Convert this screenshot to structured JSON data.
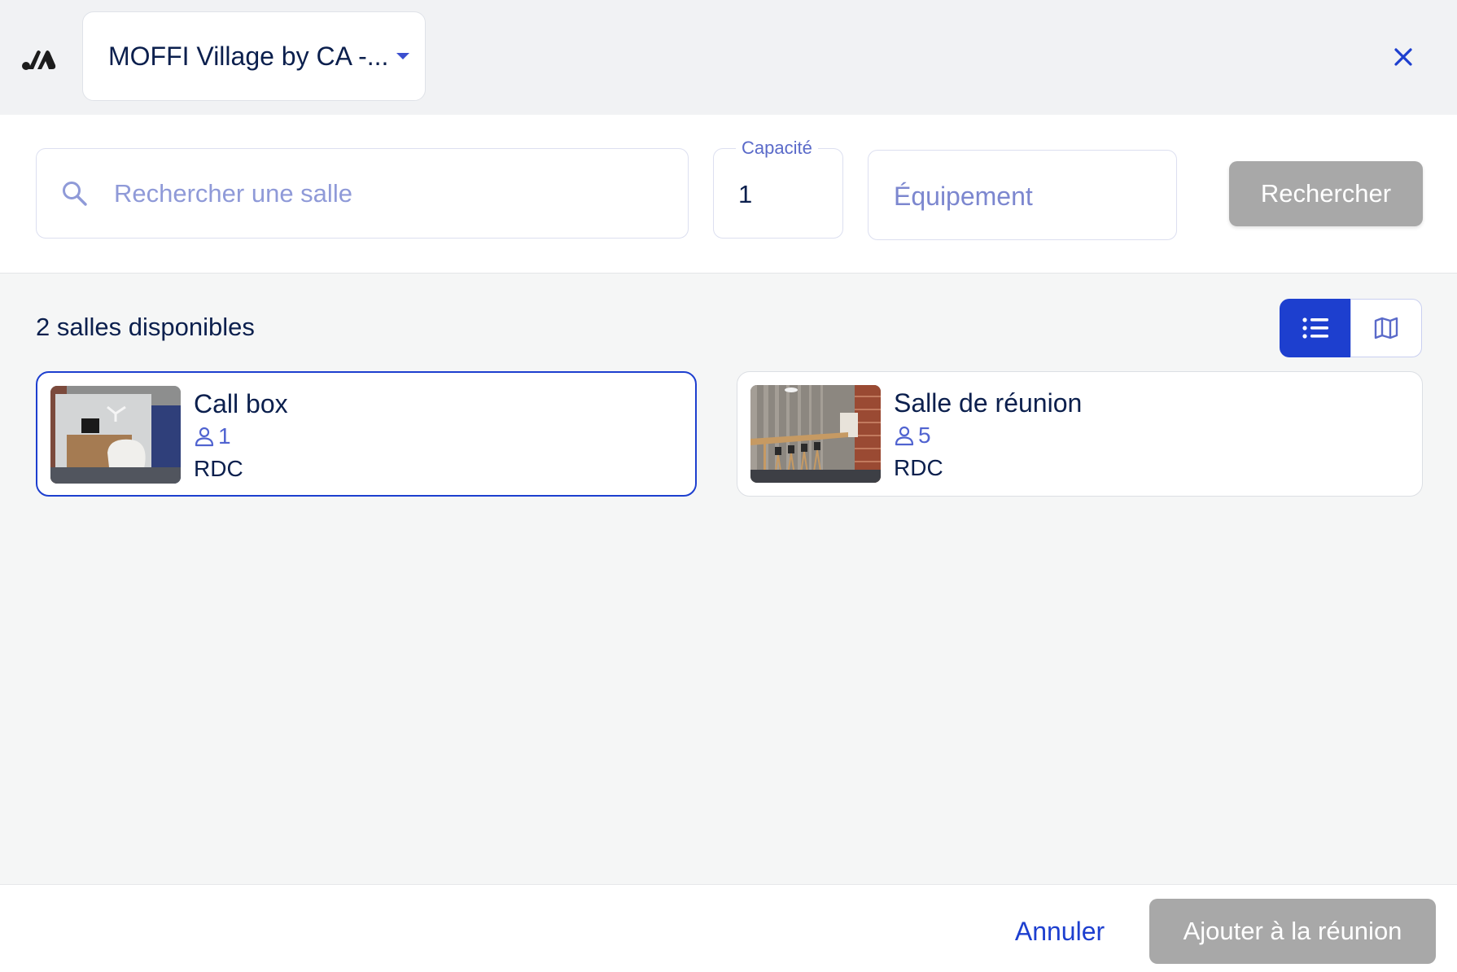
{
  "header": {
    "site_selector": {
      "label": "MOFFI Village by CA -..."
    },
    "icons": {
      "logo": "moffi-logo",
      "caret": "caret-down-icon",
      "close": "close-icon"
    }
  },
  "search": {
    "room_query": {
      "placeholder": "Rechercher une salle",
      "value": ""
    },
    "capacity": {
      "label": "Capacité",
      "value": "1"
    },
    "equipment": {
      "placeholder": "Équipement"
    },
    "submit_label": "Rechercher"
  },
  "results": {
    "count_label": "2 salles disponibles",
    "view_toggle": {
      "active": "list",
      "options": [
        "list-icon",
        "map-icon"
      ]
    },
    "rooms": [
      {
        "name": "Call box",
        "capacity": "1",
        "floor": "RDC",
        "selected": true
      },
      {
        "name": "Salle de réunion",
        "capacity": "5",
        "floor": "RDC",
        "selected": false
      }
    ]
  },
  "footer": {
    "cancel_label": "Annuler",
    "confirm_label": "Ajouter à la réunion"
  },
  "colors": {
    "primary": "#1d3fcf",
    "text_dark": "#0b1f4d",
    "disabled_button": "#a8a8a8",
    "header_bg": "#f1f2f4",
    "content_bg": "#f5f6f6"
  }
}
